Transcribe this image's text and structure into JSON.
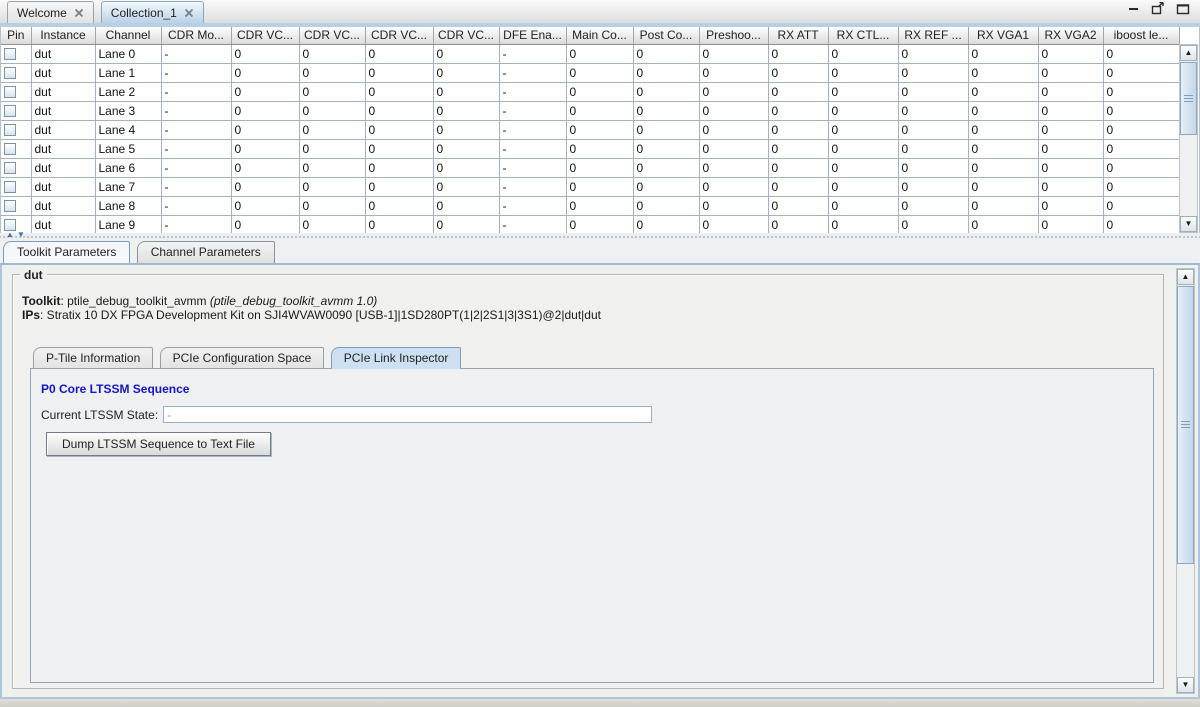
{
  "colors": {
    "accent_blue": "#1414cc",
    "active_tab_blue": "#b9d2e6",
    "grid_line": "#a4b2c2",
    "panel_border": "#abc6dd"
  },
  "icons": {
    "close": "✕",
    "minimize": "minus",
    "float": "float-window",
    "maximize": "maximize-window",
    "scroll_up": "▲",
    "scroll_down": "▼",
    "splitter_collapse": "▲",
    "splitter_expand": "▼"
  },
  "window": {
    "tabs": [
      {
        "label": "Welcome",
        "active": false
      },
      {
        "label": "Collection_1",
        "active": true
      }
    ]
  },
  "table": {
    "columns": [
      "Pin",
      "Instance",
      "Channel",
      "CDR Mo...",
      "CDR VC...",
      "CDR VC...",
      "CDR VC...",
      "CDR VC...",
      "DFE Ena...",
      "Main Co...",
      "Post Co...",
      "Preshoo...",
      "RX ATT",
      "RX CTL...",
      "RX REF ...",
      "RX VGA1",
      "RX VGA2",
      "iboost le..."
    ],
    "rows": [
      {
        "instance": "dut",
        "channel": "Lane 0",
        "values": [
          "-",
          "0",
          "0",
          "0",
          "0",
          "-",
          "0",
          "0",
          "0",
          "0",
          "0",
          "0",
          "0",
          "0",
          "0"
        ]
      },
      {
        "instance": "dut",
        "channel": "Lane 1",
        "values": [
          "-",
          "0",
          "0",
          "0",
          "0",
          "-",
          "0",
          "0",
          "0",
          "0",
          "0",
          "0",
          "0",
          "0",
          "0"
        ]
      },
      {
        "instance": "dut",
        "channel": "Lane 2",
        "values": [
          "-",
          "0",
          "0",
          "0",
          "0",
          "-",
          "0",
          "0",
          "0",
          "0",
          "0",
          "0",
          "0",
          "0",
          "0"
        ]
      },
      {
        "instance": "dut",
        "channel": "Lane 3",
        "values": [
          "-",
          "0",
          "0",
          "0",
          "0",
          "-",
          "0",
          "0",
          "0",
          "0",
          "0",
          "0",
          "0",
          "0",
          "0"
        ]
      },
      {
        "instance": "dut",
        "channel": "Lane 4",
        "values": [
          "-",
          "0",
          "0",
          "0",
          "0",
          "-",
          "0",
          "0",
          "0",
          "0",
          "0",
          "0",
          "0",
          "0",
          "0"
        ]
      },
      {
        "instance": "dut",
        "channel": "Lane 5",
        "values": [
          "-",
          "0",
          "0",
          "0",
          "0",
          "-",
          "0",
          "0",
          "0",
          "0",
          "0",
          "0",
          "0",
          "0",
          "0"
        ]
      },
      {
        "instance": "dut",
        "channel": "Lane 6",
        "values": [
          "-",
          "0",
          "0",
          "0",
          "0",
          "-",
          "0",
          "0",
          "0",
          "0",
          "0",
          "0",
          "0",
          "0",
          "0"
        ]
      },
      {
        "instance": "dut",
        "channel": "Lane 7",
        "values": [
          "-",
          "0",
          "0",
          "0",
          "0",
          "-",
          "0",
          "0",
          "0",
          "0",
          "0",
          "0",
          "0",
          "0",
          "0"
        ]
      },
      {
        "instance": "dut",
        "channel": "Lane 8",
        "values": [
          "-",
          "0",
          "0",
          "0",
          "0",
          "-",
          "0",
          "0",
          "0",
          "0",
          "0",
          "0",
          "0",
          "0",
          "0"
        ]
      },
      {
        "instance": "dut",
        "channel": "Lane 9",
        "values": [
          "-",
          "0",
          "0",
          "0",
          "0",
          "-",
          "0",
          "0",
          "0",
          "0",
          "0",
          "0",
          "0",
          "0",
          "0"
        ]
      }
    ]
  },
  "bottom_tabs": [
    {
      "label": "Toolkit Parameters",
      "active": true
    },
    {
      "label": "Channel Parameters",
      "active": false
    }
  ],
  "panel": {
    "group_title": "dut",
    "toolkit_label": "Toolkit",
    "toolkit_text": ": ptile_debug_toolkit_avmm ",
    "toolkit_version": "(ptile_debug_toolkit_avmm 1.0)",
    "ips_label": "IPs",
    "ips_text": ": Stratix 10 DX FPGA Development Kit on SJI4WVAW0090 [USB-1]|1SD280PT(1|2|2S1|3|3S1)@2|dut|dut",
    "inner_tabs": [
      {
        "label": "P-Tile Information",
        "active": false
      },
      {
        "label": "PCIe Configuration Space",
        "active": false
      },
      {
        "label": "PCIe Link Inspector",
        "active": true
      }
    ],
    "section_title": "P0 Core LTSSM Sequence",
    "ltssm_label": "Current LTSSM State:",
    "ltssm_value": "-",
    "dump_button_label": "Dump LTSSM Sequence to Text File"
  }
}
